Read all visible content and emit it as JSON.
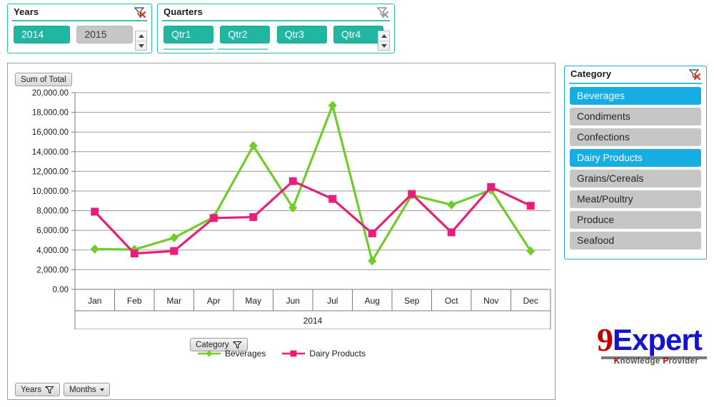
{
  "slicers": {
    "years": {
      "title": "Years",
      "clear_icon": "clear-filter-icon",
      "items": [
        {
          "label": "2014",
          "selected": true
        },
        {
          "label": "2015",
          "selected": false
        }
      ]
    },
    "quarters": {
      "title": "Quarters",
      "clear_icon": "clear-filter-icon",
      "items": [
        {
          "label": "Qtr1",
          "selected": true
        },
        {
          "label": "Qtr2",
          "selected": true
        },
        {
          "label": "Qtr3",
          "selected": true
        },
        {
          "label": "Qtr4",
          "selected": true
        }
      ]
    },
    "category": {
      "title": "Category",
      "clear_icon": "clear-filter-icon",
      "items": [
        {
          "label": "Beverages",
          "selected": true
        },
        {
          "label": "Condiments",
          "selected": false
        },
        {
          "label": "Confections",
          "selected": false
        },
        {
          "label": "Dairy Products",
          "selected": true
        },
        {
          "label": "Grains/Cereals",
          "selected": false
        },
        {
          "label": "Meat/Poultry",
          "selected": false
        },
        {
          "label": "Produce",
          "selected": false
        },
        {
          "label": "Seafood",
          "selected": false
        }
      ]
    }
  },
  "chart_buttons": {
    "value_field": "Sum of Total",
    "category_field": "Category",
    "years_field": "Years",
    "months_field": "Months"
  },
  "colors": {
    "teal": "#20B6A2",
    "teal_off": "#C6C6C6",
    "blue": "#17ADE3",
    "beverages": "#70CC28",
    "dairy": "#E81E78",
    "gridline": "#9a9a9a",
    "frame": "#9e9e9e",
    "logo_red": "#C00000",
    "logo_blue": "#1414CC"
  },
  "chart_data": {
    "type": "line",
    "title": "Sum of Total",
    "xlabel": "2014",
    "ylabel": "",
    "grid": true,
    "legend_position": "bottom",
    "ylim": [
      0,
      20000
    ],
    "ytick_labels": [
      "0.00",
      "2,000.00",
      "4,000.00",
      "6,000.00",
      "8,000.00",
      "10,000.00",
      "12,000.00",
      "14,000.00",
      "16,000.00",
      "18,000.00",
      "20,000.00"
    ],
    "ytick_values": [
      0,
      2000,
      4000,
      6000,
      8000,
      10000,
      12000,
      14000,
      16000,
      18000,
      20000
    ],
    "categories": [
      "Jan",
      "Feb",
      "Mar",
      "Apr",
      "May",
      "Jun",
      "Jul",
      "Aug",
      "Sep",
      "Oct",
      "Nov",
      "Dec"
    ],
    "series": [
      {
        "name": "Beverages",
        "color": "#70CC28",
        "marker": "diamond",
        "values": [
          4100,
          4050,
          5250,
          7350,
          14600,
          8300,
          18700,
          2900,
          9600,
          8600,
          10100,
          3900
        ]
      },
      {
        "name": "Dairy Products",
        "color": "#E81E78",
        "marker": "square",
        "values": [
          7900,
          3650,
          3900,
          7250,
          7350,
          11000,
          9200,
          5700,
          9700,
          5800,
          10400,
          8500
        ]
      }
    ]
  },
  "logo": {
    "nine": "9",
    "expert": "Expert",
    "tagline_first": "K",
    "tagline": "nowledge Provider",
    "tagline_p": "P"
  }
}
